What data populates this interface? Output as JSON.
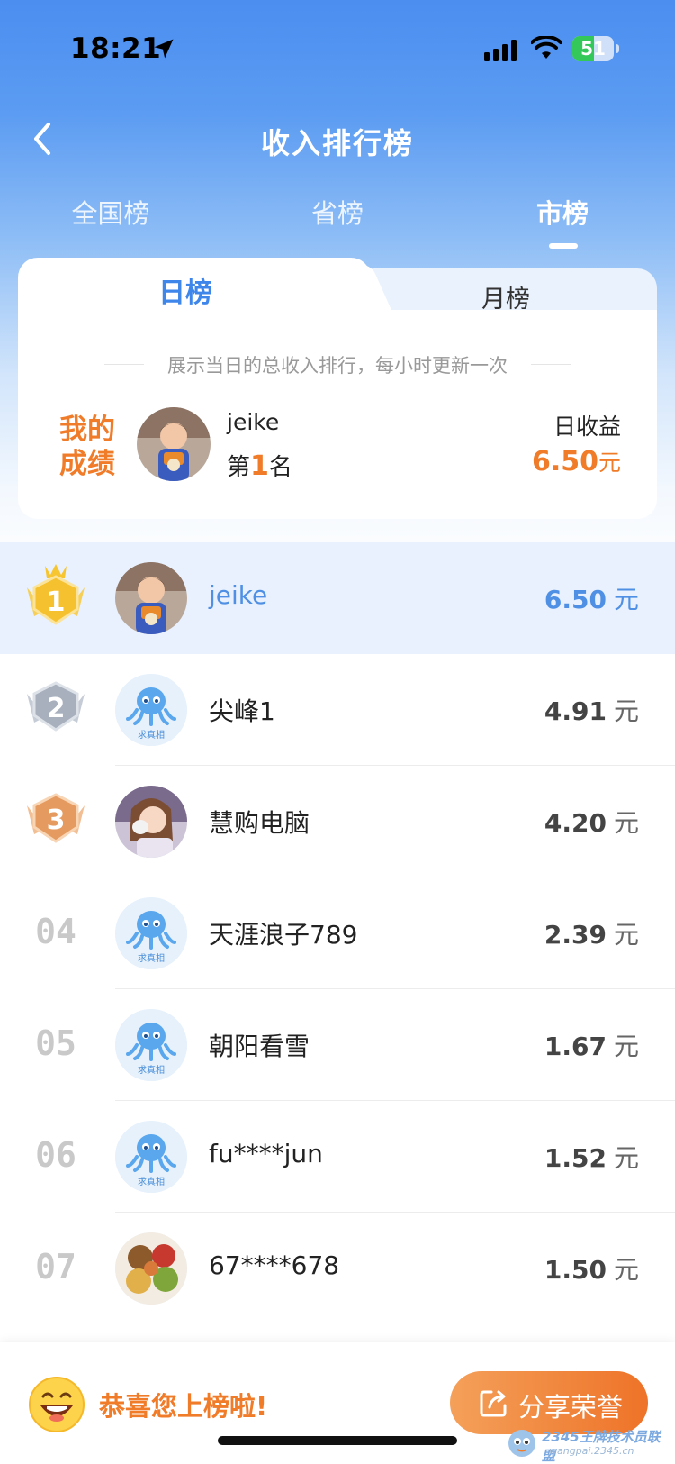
{
  "status_bar": {
    "time": "18:21",
    "battery": "51"
  },
  "header": {
    "title": "收入排行榜"
  },
  "scope_tabs": [
    {
      "label": "全国榜",
      "active": false
    },
    {
      "label": "省榜",
      "active": false
    },
    {
      "label": "市榜",
      "active": true
    }
  ],
  "period_tabs": {
    "active": "日榜",
    "inactive": "月榜"
  },
  "period_hint": "展示当日的总收入排行，每小时更新一次",
  "my_score": {
    "label": "我的成绩",
    "name": "jeike",
    "rank_prefix": "第",
    "rank": "1",
    "rank_suffix": "名",
    "earn_label": "日收益",
    "earn_value": "6.50",
    "earn_unit": "元"
  },
  "ranking": [
    {
      "rank": "1",
      "medal": "gold",
      "name": "jeike",
      "earn": "6.50",
      "unit": "元",
      "avatar": "child-photo",
      "highlight": true
    },
    {
      "rank": "2",
      "medal": "silver",
      "name": "尖峰1",
      "earn": "4.91",
      "unit": "元",
      "avatar": "octopus-default"
    },
    {
      "rank": "3",
      "medal": "bronze",
      "name": "慧购电脑",
      "earn": "4.20",
      "unit": "元",
      "avatar": "girl-photo"
    },
    {
      "rank": "04",
      "name": "天涯浪子789",
      "earn": "2.39",
      "unit": "元",
      "avatar": "octopus-default"
    },
    {
      "rank": "05",
      "name": "朝阳看雪",
      "earn": "1.67",
      "unit": "元",
      "avatar": "octopus-default"
    },
    {
      "rank": "06",
      "name": "fu****jun",
      "earn": "1.52",
      "unit": "元",
      "avatar": "octopus-default"
    },
    {
      "rank": "07",
      "name": "67****678",
      "earn": "1.50",
      "unit": "元",
      "avatar": "food-photo"
    }
  ],
  "octopus_caption": "求真相",
  "bottom_bar": {
    "congrats": "恭喜您上榜啦!",
    "share_label": "分享荣誉"
  },
  "watermark": {
    "text": "2345王牌技术员联盟",
    "sub": "wangpai.2345.cn"
  },
  "colors": {
    "accent_blue": "#3e86ea",
    "accent_orange": "#f07c2a",
    "highlight_row": "#e8f1fd"
  }
}
